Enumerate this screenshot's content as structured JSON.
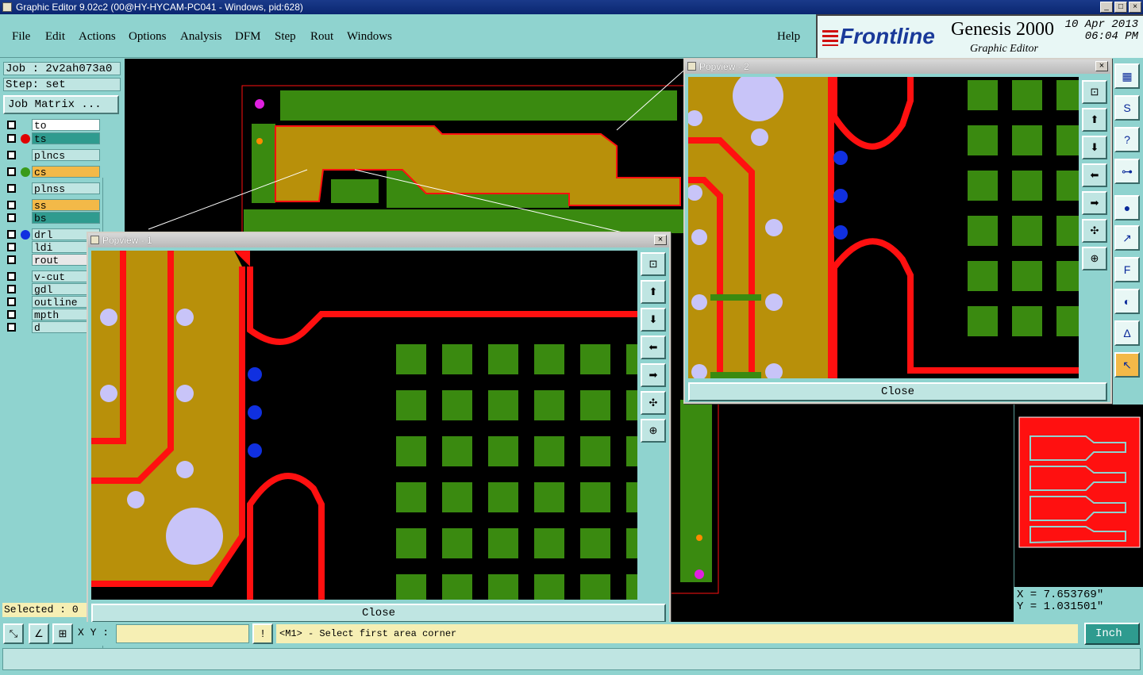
{
  "window": {
    "title": "Graphic Editor 9.02c2 (00@HY-HYCAM-PC041 - Windows, pid:628)"
  },
  "menu": [
    "File",
    "Edit",
    "Actions",
    "Options",
    "Analysis",
    "DFM",
    "Step",
    "Rout",
    "Windows"
  ],
  "help": "Help",
  "brand": {
    "logo": "Frontline",
    "product": "Genesis 2000",
    "subtitle": "Graphic Editor",
    "date": "10 Apr 2013",
    "time": "06:04 PM"
  },
  "job": {
    "job_line": "Job : 2v2ah073a0",
    "step_line": "Step: set",
    "matrix_button": "Job Matrix ..."
  },
  "layers": [
    {
      "name": "to",
      "bg": "#ffffff",
      "dot": ""
    },
    {
      "name": "ts",
      "bg": "#2f9b8f",
      "dot": "#e00000"
    },
    {
      "name": "plncs",
      "bg": "#bfe5e2",
      "dot": ""
    },
    {
      "name": "cs",
      "bg": "#f3b948",
      "dot": "#3a9a1a"
    },
    {
      "name": "plnss",
      "bg": "#bfe5e2",
      "dot": ""
    },
    {
      "name": "ss",
      "bg": "#f3b948",
      "dot": ""
    },
    {
      "name": "bs",
      "bg": "#2f9b8f",
      "dot": ""
    },
    {
      "name": "drl",
      "bg": "#bfe5e2",
      "dot": "#1030e0"
    },
    {
      "name": "ldi",
      "bg": "#bfe5e2",
      "dot": ""
    },
    {
      "name": "rout",
      "bg": "#e8e8e8",
      "dot": ""
    },
    {
      "name": "v-cut",
      "bg": "#bfe5e2",
      "dot": ""
    },
    {
      "name": "gdl",
      "bg": "#bfe5e2",
      "dot": ""
    },
    {
      "name": "outline",
      "bg": "#bfe5e2",
      "dot": ""
    },
    {
      "name": "mpth",
      "bg": "#bfe5e2",
      "dot": ""
    },
    {
      "name": "d",
      "bg": "#bfe5e2",
      "dot": ""
    }
  ],
  "selected": "Selected : 0",
  "popups": [
    {
      "title": "Popview - 1",
      "close": "Close"
    },
    {
      "title": "Popview - 2",
      "close": "Close"
    }
  ],
  "coords": {
    "x": "X = 7.653769\"",
    "y": "Y = 1.031501\""
  },
  "status": {
    "xy_label": "X Y :",
    "xy_value": "",
    "message": "<M1> - Select first area corner",
    "unit": "Inch"
  },
  "colors": {
    "copper": "#b8900a",
    "trace": "#ff1010",
    "pad": "#3a8a10",
    "hole": "#c8c4f8",
    "via": "#1030e0",
    "panel": "#8fd3cf"
  },
  "right_tools": [
    "layout-icon",
    "s-route-icon",
    "help-icon",
    "measure-icon",
    "pad-icon",
    "snap-icon",
    "flip-icon",
    "shapes-icon",
    "arc-icon",
    "pointer-icon"
  ],
  "popup_tools": [
    "zoom-icon",
    "up-icon",
    "down-icon",
    "left-icon",
    "right-icon",
    "fit-icon",
    "center-icon"
  ]
}
